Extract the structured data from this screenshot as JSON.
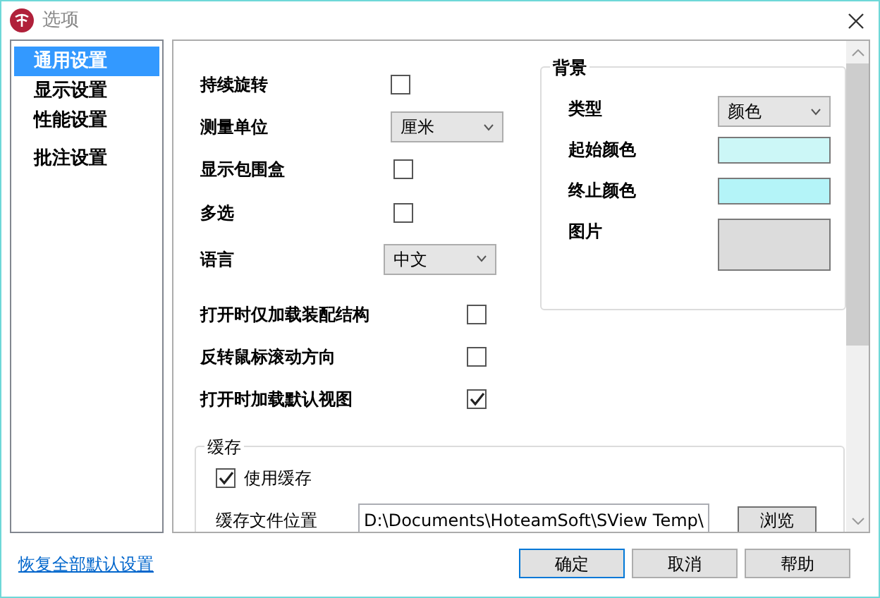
{
  "window": {
    "title": "选项"
  },
  "sidebar": {
    "items": [
      {
        "label": "通用设置",
        "selected": true
      },
      {
        "label": "显示设置",
        "selected": false
      },
      {
        "label": "性能设置",
        "selected": false
      },
      {
        "label": "批注设置",
        "selected": false
      }
    ]
  },
  "general": [
    {
      "kind": "checkbox",
      "label": "持续旋转",
      "checked": false
    },
    {
      "kind": "dropdown",
      "label": "测量单位",
      "value": "厘米"
    },
    {
      "kind": "checkbox",
      "label": "显示包围盒",
      "checked": false
    },
    {
      "kind": "checkbox",
      "label": "多选",
      "checked": false
    },
    {
      "kind": "dropdown",
      "label": "语言",
      "value": "中文"
    }
  ],
  "background": {
    "title": "背景",
    "rows": [
      {
        "kind": "dropdown",
        "label": "类型",
        "value": "颜色"
      },
      {
        "kind": "color",
        "label": "起始颜色",
        "color": "#ccf7f7"
      },
      {
        "kind": "color",
        "label": "终止颜色",
        "color": "#b4f4f8"
      },
      {
        "kind": "image",
        "label": "图片"
      }
    ]
  },
  "options": [
    {
      "label": "打开时仅加载装配结构",
      "checked": false
    },
    {
      "label": "反转鼠标滚动方向",
      "checked": false
    },
    {
      "label": "打开时加载默认视图",
      "checked": true
    }
  ],
  "cache": {
    "title": "缓存",
    "use_cache": {
      "label": "使用缓存",
      "checked": true
    },
    "location_label": "缓存文件位置",
    "location": "D:\\Documents\\HoteamSoft\\SView Temp\\",
    "browse": "浏览"
  },
  "restore_link": "恢复全部默认设置",
  "buttons": [
    {
      "label": "确定",
      "default": true
    },
    {
      "label": "取消",
      "default": false
    },
    {
      "label": "帮助",
      "default": false
    }
  ]
}
